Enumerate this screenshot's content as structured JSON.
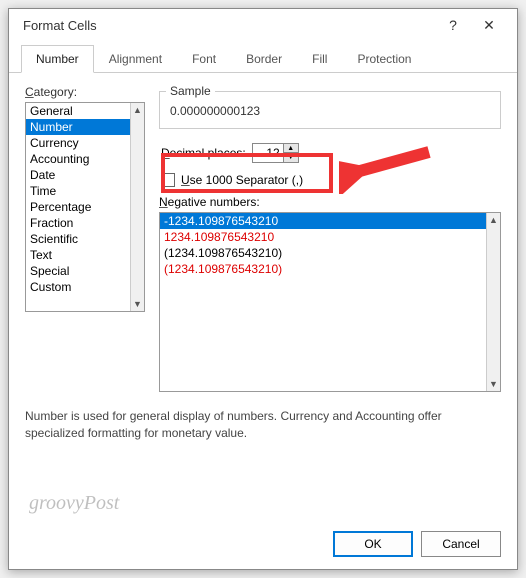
{
  "dialog": {
    "title": "Format Cells",
    "help": "?",
    "close": "✕"
  },
  "tabs": [
    "Number",
    "Alignment",
    "Font",
    "Border",
    "Fill",
    "Protection"
  ],
  "category": {
    "label": "Category:",
    "items": [
      "General",
      "Number",
      "Currency",
      "Accounting",
      "Date",
      "Time",
      "Percentage",
      "Fraction",
      "Scientific",
      "Text",
      "Special",
      "Custom"
    ],
    "selected": "Number"
  },
  "sample": {
    "label": "Sample",
    "value": "0.000000000123"
  },
  "decimal": {
    "label": "Decimal places:",
    "value": "12"
  },
  "separator": {
    "label": "Use 1000 Separator (,)"
  },
  "negative": {
    "label": "Negative numbers:",
    "items": [
      {
        "text": "-1234.109876543210",
        "red": false,
        "selected": true
      },
      {
        "text": "1234.109876543210",
        "red": true,
        "selected": false
      },
      {
        "text": "(1234.109876543210)",
        "red": false,
        "selected": false
      },
      {
        "text": "(1234.109876543210)",
        "red": true,
        "selected": false
      }
    ]
  },
  "description": "Number is used for general display of numbers.  Currency and Accounting offer specialized formatting for monetary value.",
  "buttons": {
    "ok": "OK",
    "cancel": "Cancel"
  },
  "watermark": "groovyPost"
}
